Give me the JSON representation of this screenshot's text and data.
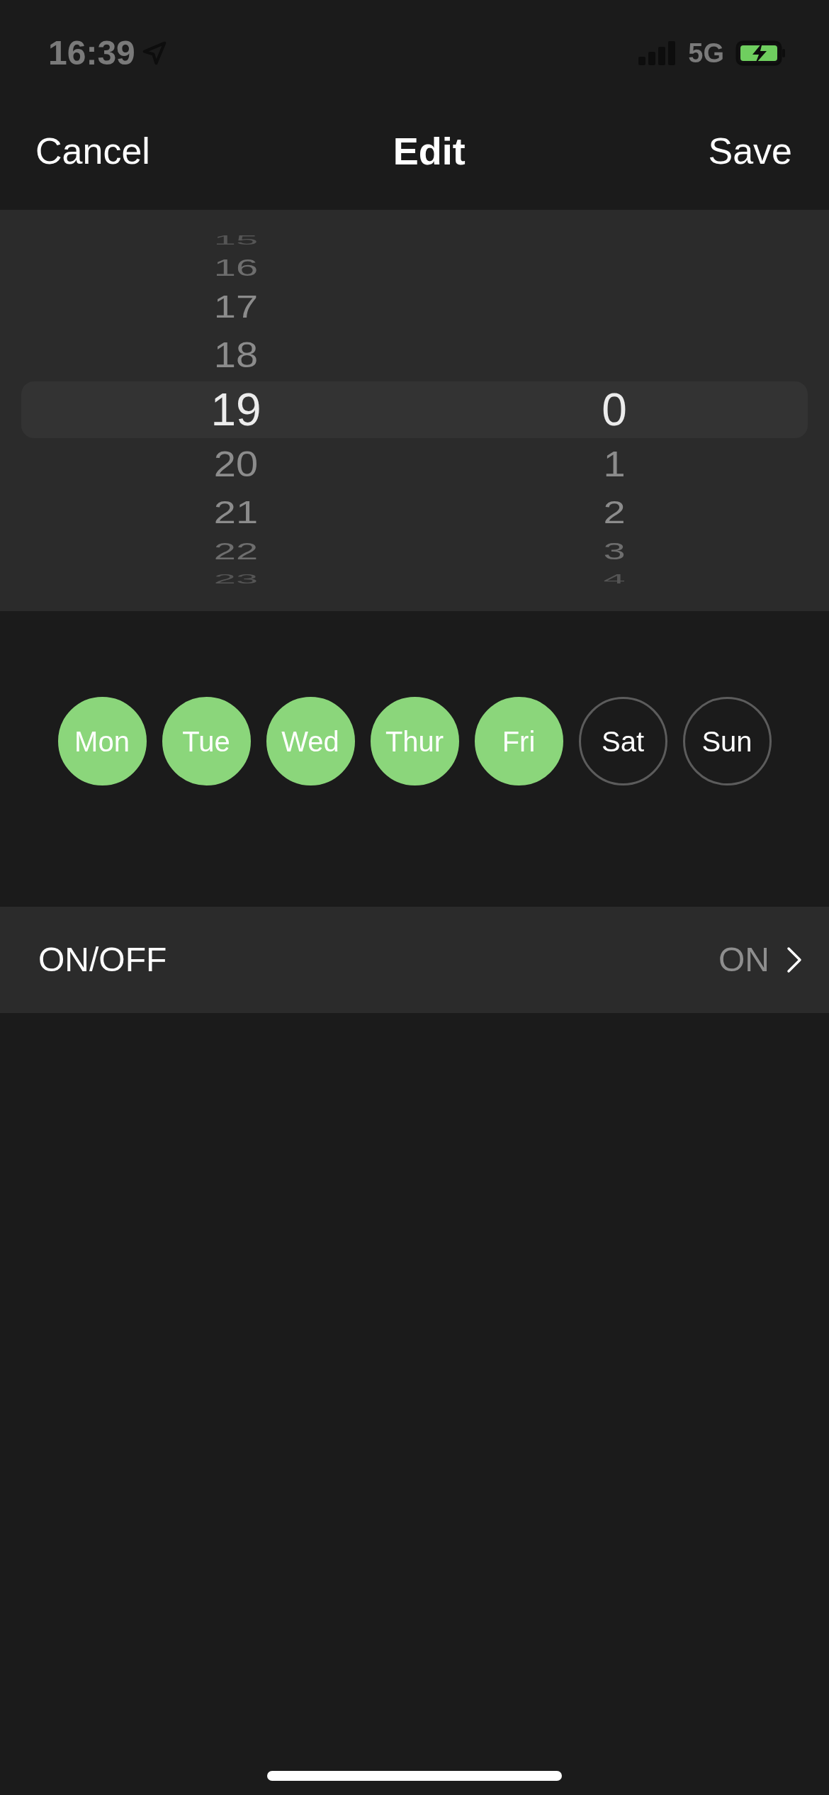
{
  "status_bar": {
    "time": "16:39",
    "network": "5G"
  },
  "nav": {
    "cancel": "Cancel",
    "title": "Edit",
    "save": "Save"
  },
  "picker": {
    "columns": [
      {
        "items": [
          {
            "label": "15",
            "selected": false
          },
          {
            "label": "16",
            "selected": false
          },
          {
            "label": "17",
            "selected": false
          },
          {
            "label": "18",
            "selected": false
          },
          {
            "label": "19",
            "selected": true
          },
          {
            "label": "20",
            "selected": false
          },
          {
            "label": "21",
            "selected": false
          },
          {
            "label": "22",
            "selected": false
          },
          {
            "label": "23",
            "selected": false
          }
        ]
      },
      {
        "items": [
          {
            "label": "0",
            "selected": true
          },
          {
            "label": "1",
            "selected": false
          },
          {
            "label": "2",
            "selected": false
          },
          {
            "label": "3",
            "selected": false
          },
          {
            "label": "4",
            "selected": false
          }
        ]
      }
    ]
  },
  "days": [
    {
      "label": "Mon",
      "selected": true
    },
    {
      "label": "Tue",
      "selected": true
    },
    {
      "label": "Wed",
      "selected": true
    },
    {
      "label": "Thur",
      "selected": true
    },
    {
      "label": "Fri",
      "selected": true
    },
    {
      "label": "Sat",
      "selected": false
    },
    {
      "label": "Sun",
      "selected": false
    }
  ],
  "settings": [
    {
      "label": "ON/OFF",
      "value": "ON"
    }
  ]
}
